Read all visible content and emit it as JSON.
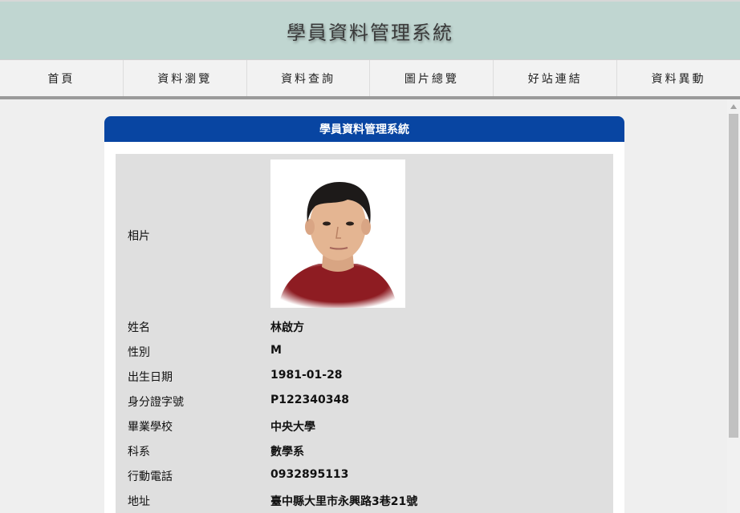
{
  "header": {
    "title": "學員資料管理系統"
  },
  "nav": {
    "items": [
      "首頁",
      "資料瀏覽",
      "資料查詢",
      "圖片總覽",
      "好站連結",
      "資料異動"
    ]
  },
  "panel": {
    "title": "學員資料管理系統"
  },
  "record": {
    "photo_label": "相片",
    "fields": [
      {
        "label": "姓名",
        "value": "林啟方"
      },
      {
        "label": "性別",
        "value": "M"
      },
      {
        "label": "出生日期",
        "value": "1981-01-28"
      },
      {
        "label": "身分證字號",
        "value": "P122340348"
      },
      {
        "label": "畢業學校",
        "value": "中央大學"
      },
      {
        "label": "科系",
        "value": "數學系"
      },
      {
        "label": "行動電話",
        "value": "0932895113"
      },
      {
        "label": "地址",
        "value": "臺中縣大里市永興路3巷21號"
      }
    ]
  },
  "colors": {
    "header_bg": "#c0d6d1",
    "panel_header_bg": "#0845a2",
    "info_bg": "#dfdfdf"
  }
}
